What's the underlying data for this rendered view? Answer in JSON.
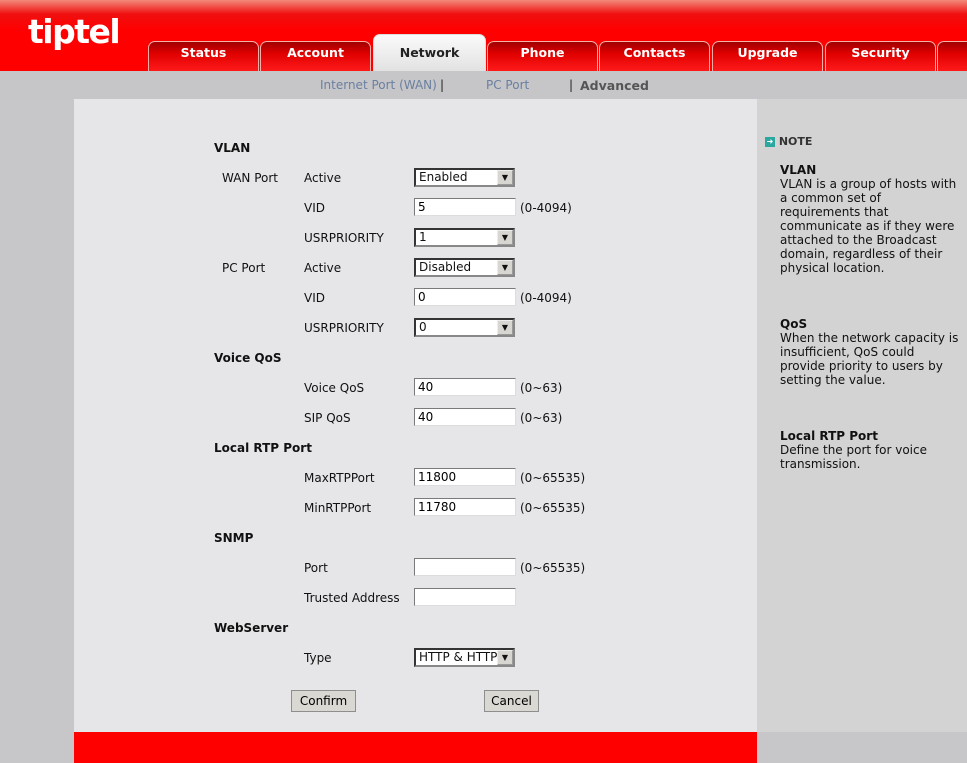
{
  "brand": "tiptel",
  "tabs": [
    "Status",
    "Account",
    "Network",
    "Phone",
    "Contacts",
    "Upgrade",
    "Security"
  ],
  "active_tab": "Network",
  "subnav": {
    "wan": "Internet Port (WAN)",
    "pc": "PC Port",
    "advanced": "Advanced",
    "sep": "|"
  },
  "form": {
    "vlan": "VLAN",
    "wan_port": "WAN Port",
    "pc_port": "PC Port",
    "active": "Active",
    "vid": "VID",
    "usrpriority": "USRPRIORITY",
    "wan_active": "Enabled",
    "wan_vid": "5",
    "wan_prio": "1",
    "pc_active": "Disabled",
    "pc_vid": "0",
    "pc_prio": "0",
    "vid_range": "(0-4094)",
    "voice_qos_title": "Voice QoS",
    "voice_qos": "Voice QoS",
    "voice_qos_val": "40",
    "sip_qos": "SIP QoS",
    "sip_qos_val": "40",
    "qos_range": "(0~63)",
    "rtp_title": "Local RTP Port",
    "max_rtp": "MaxRTPPort",
    "max_rtp_val": "11800",
    "min_rtp": "MinRTPPort",
    "min_rtp_val": "11780",
    "port_range": "(0~65535)",
    "snmp_title": "SNMP",
    "port": "Port",
    "port_val": "",
    "trusted": "Trusted Address",
    "trusted_val": "",
    "web_title": "WebServer",
    "type": "Type",
    "type_val": "HTTP & HTTPS",
    "confirm": "Confirm",
    "cancel": "Cancel"
  },
  "note": {
    "title": "NOTE",
    "items": [
      {
        "title": "VLAN",
        "text": "VLAN is a group of hosts with a common set of requirements that communicate as if they were attached to the Broadcast domain, regardless of their physical location."
      },
      {
        "title": "QoS",
        "text": "When the network capacity is insufficient, QoS could provide priority to users by setting the value."
      },
      {
        "title": "Local RTP Port",
        "text": "Define the port for voice transmission."
      }
    ]
  },
  "colors": {
    "brand_red": "#ff0000",
    "note_icon": "#2aa8a0"
  }
}
